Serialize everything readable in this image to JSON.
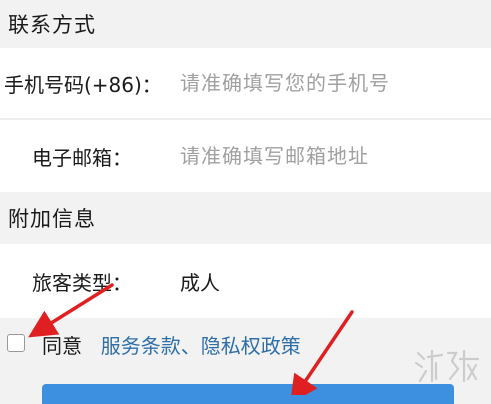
{
  "contact_section": {
    "title": "联系方式"
  },
  "phone": {
    "label": "手机号码(+86)：",
    "placeholder": "请准确填写您的手机号"
  },
  "email": {
    "label": "电子邮箱：",
    "placeholder": "请准确填写邮箱地址"
  },
  "extra_section": {
    "title": "附加信息"
  },
  "passenger_type": {
    "label": "旅客类型：",
    "value": "成人"
  },
  "agreement": {
    "checked": false,
    "agree_text": "同意",
    "terms_link": "服务条款",
    "separator": "、",
    "privacy_link": "隐私权政策"
  },
  "colors": {
    "link": "#2f6fa8",
    "annotation_arrow": "#e02020",
    "submit_button": "#3d8fdf"
  }
}
